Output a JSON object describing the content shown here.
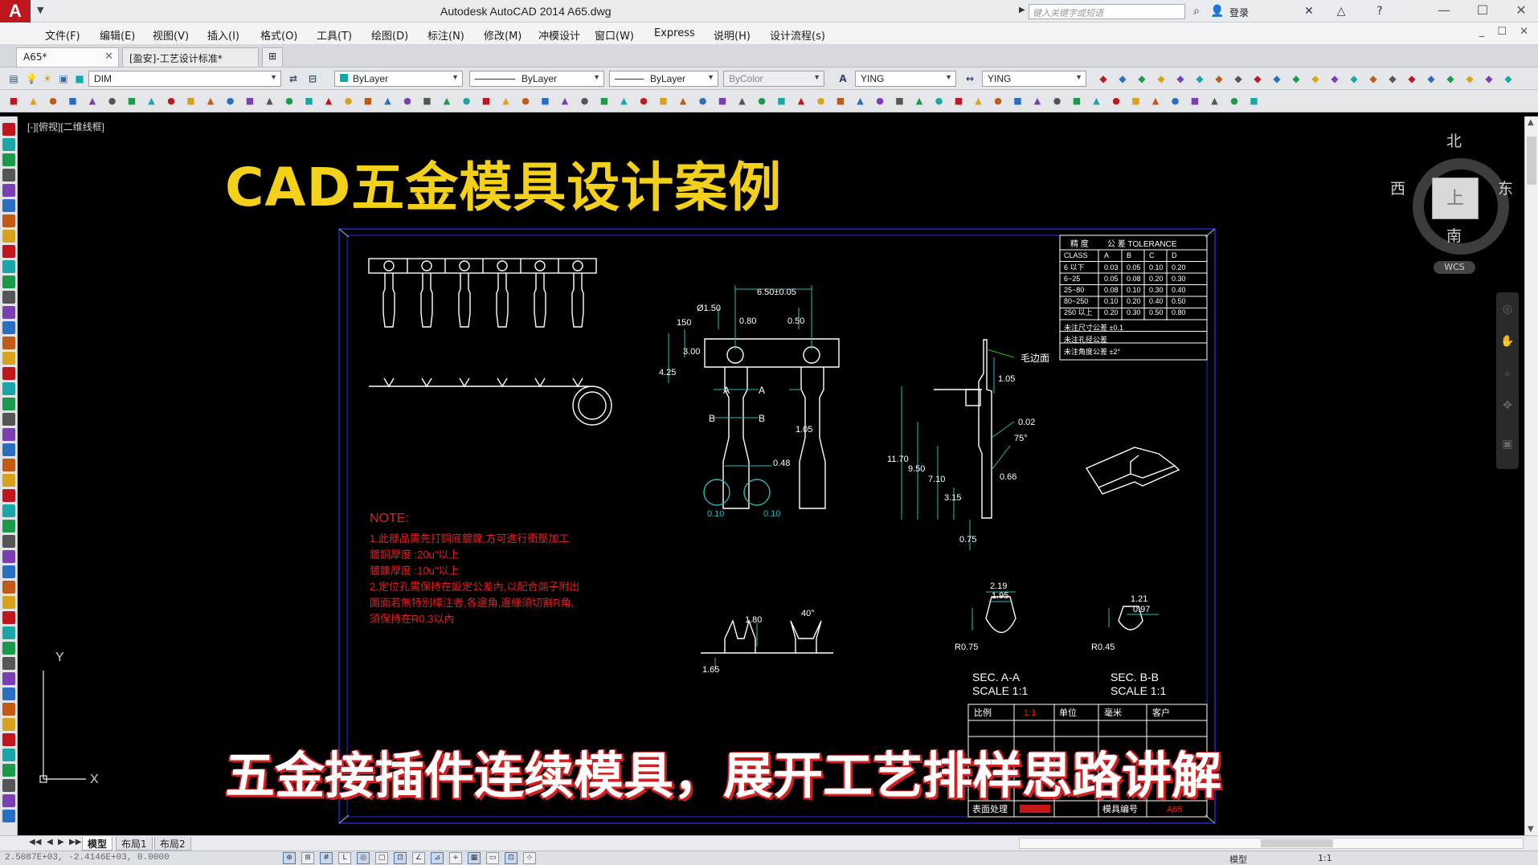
{
  "titlebar": {
    "app_title": "Autodesk AutoCAD 2014    A65.dwg",
    "search_placeholder": "键入关键字或短语",
    "login": "登录"
  },
  "menubar": {
    "items": [
      "文件(F)",
      "编辑(E)",
      "视图(V)",
      "插入(I)",
      "格式(O)",
      "工具(T)",
      "绘图(D)",
      "标注(N)",
      "修改(M)",
      "冲模设计",
      "窗口(W)",
      "Express",
      "说明(H)",
      "设计流程(s)"
    ]
  },
  "tabs": {
    "active": "A65*",
    "second": "[盈安]-工艺设计标准*"
  },
  "properties_toolbar": {
    "layer": "DIM",
    "color": "ByLayer",
    "linetype": "ByLayer",
    "lineweight": "ByLayer",
    "plotstyle": "ByColor",
    "text_style": "YING",
    "dim_style": "YING"
  },
  "canvas": {
    "view_label": "[-][俯视][二维线框]",
    "overlay_title": "CAD五金模具设计案例",
    "overlay_subtitle": "五金接插件连续模具，展开工艺排样思路讲解"
  },
  "viewcube": {
    "north": "北",
    "south": "南",
    "east": "东",
    "west": "西",
    "face": "上",
    "wcs": "WCS"
  },
  "drawing": {
    "tolerance_header": [
      "精 度",
      "公 差 TOLERANCE"
    ],
    "tolerance_cols": [
      "CLASS",
      "A",
      "B",
      "C",
      "D"
    ],
    "tolerance_rows": [
      [
        "6 以下",
        "0.03",
        "0.05",
        "0.10",
        "0.20"
      ],
      [
        "6~25",
        "0.05",
        "0.08",
        "0.20",
        "0.30"
      ],
      [
        "25~80",
        "0.08",
        "0.10",
        "0.30",
        "0.40"
      ],
      [
        "80~250",
        "0.10",
        "0.20",
        "0.40",
        "0.50"
      ],
      [
        "250 以上",
        "0.20",
        "0.30",
        "0.50",
        "0.80"
      ]
    ],
    "tolerance_notes": [
      "未注尺寸公差 ±0.1",
      "未注孔径公差",
      "未注角度公差 ±2°"
    ],
    "burr_label": "毛边面",
    "dims": {
      "pitch": "6.50±0.05",
      "hole": "Ø1.50",
      "d080": "0.80",
      "d050": "0.50",
      "d150": "150",
      "d300": "3.00",
      "d425": "4.25",
      "d048": "0.48",
      "d105": "1.05",
      "d1170": "11.70",
      "d950": "9.50",
      "d710": "7.10",
      "d315": "3.15",
      "d075": "0.75",
      "d002": "0.02",
      "d066": "0.66",
      "a75": "75°",
      "r010a": "0.10",
      "r010b": "0.10",
      "d180": "1.80",
      "a40": "40°",
      "d165": "1.65",
      "d219": "2.19",
      "d195": "1.95",
      "d121": "1.21",
      "d097": "0.97",
      "r075": "R0.75",
      "r045": "R0.45",
      "sec_aa": "SEC. A-A",
      "sec_bb": "SEC. B-B",
      "scale1": "SCALE 1:1",
      "scale2": "SCALE 1:1"
    },
    "note_title": "NOTE:",
    "notes": [
      "1.此部品需先打銅底鍍鎳,方可進行衝壓加工",
      "  鍍銅厚度 :20u\"以上",
      "  鍍鎳厚度 :10u\"以上",
      "2.定位孔需保持在設定公差內,以配合端子附出",
      "  圖面若無特別標注者,各邊角,邊緣須切割R角,",
      "  須保持在R0.3以內"
    ],
    "titleblock": [
      "比例",
      "1:1",
      "单位",
      "毫米",
      "客户",
      "表面处理",
      "模具编号",
      "A65"
    ]
  },
  "layout_tabs": [
    "模型",
    "布局1",
    "布局2"
  ],
  "statusbar": {
    "coords": "2.5087E+03, -2.4146E+03, 0.0000",
    "model": "模型",
    "scale": "1:1"
  },
  "colors": {
    "title_yellow": "#f3d11b",
    "subtitle_shadow": "#d32121",
    "drawing_white": "#ffffff",
    "border_blue": "#2b2bd6",
    "dim_cyan": "#2fb8b8",
    "note_red": "#e02020"
  }
}
